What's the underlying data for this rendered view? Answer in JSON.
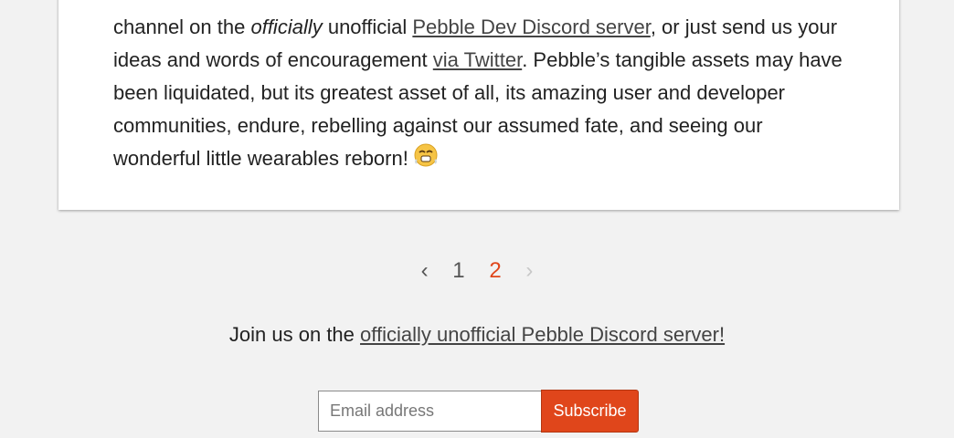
{
  "article": {
    "p1_start": "channel on the ",
    "p1_em": "officially",
    "p1_mid": " unofficial ",
    "discord_dev_link": "Pebble Dev Discord server",
    "p1_after": ", or just send us your ideas and words of encouragement ",
    "twitter_link": "via Twitter",
    "p1_end": ". Pebble’s tangible assets may have been liquidated, but its greatest asset of all, its amazing user and developer communities, endure, rebelling against our assumed fate, and seeing our wonderful little wearables reborn! ",
    "emoji_icon": "steam-face-emoji-icon"
  },
  "pagination": {
    "prev": "‹",
    "pages": [
      "1",
      "2"
    ],
    "current": "2",
    "next": "›"
  },
  "footer": {
    "join_text": "Join us on the ",
    "discord_link": "officially unofficial Pebble Discord server!"
  },
  "subscribe": {
    "email_placeholder": "Email address",
    "email_value": "",
    "button_label": "Subscribe"
  },
  "colors": {
    "accent": "#e0461b",
    "background": "#f2f2f2",
    "card": "#ffffff"
  }
}
